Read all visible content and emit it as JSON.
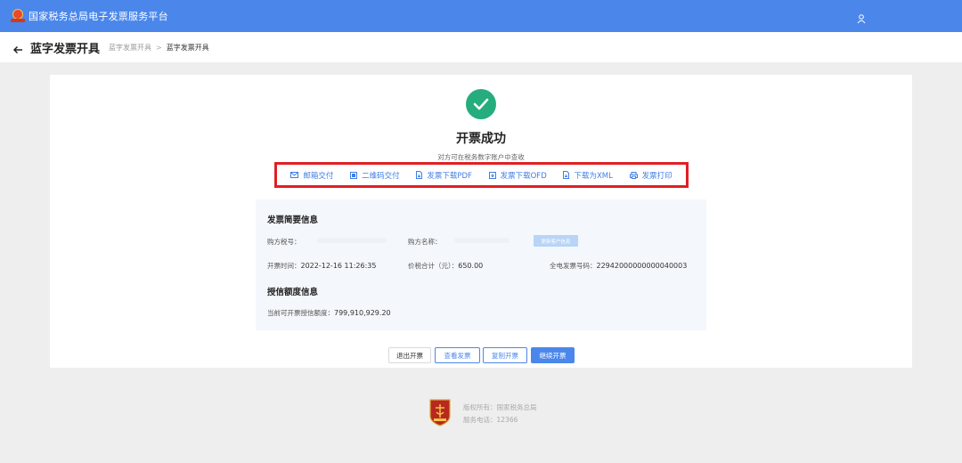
{
  "header": {
    "app_title": "国家税务总局电子发票服务平台",
    "logo_icon": "tax-bureau-logo-icon",
    "user_icon": "user-icon",
    "brand_color": "#4b87ea"
  },
  "subheader": {
    "back_icon": "arrow-left-icon",
    "page_title": "蓝字发票开具",
    "breadcrumb": [
      "蓝字发票开具",
      "蓝字发票开具"
    ],
    "breadcrumb_sep": ">"
  },
  "result": {
    "status_icon": "check-circle-icon",
    "success_color": "#26ad7d",
    "title": "开票成功",
    "hint": "对方可在税务数字账户中查收"
  },
  "delivery_actions": [
    {
      "label": "邮箱交付",
      "icon": "mail-icon"
    },
    {
      "label": "二维码交付",
      "icon": "qrcode-icon"
    },
    {
      "label": "发票下载PDF",
      "icon": "document-icon"
    },
    {
      "label": "发票下载OFD",
      "icon": "download-icon"
    },
    {
      "label": "下载为XML",
      "icon": "document-icon"
    },
    {
      "label": "发票打印",
      "icon": "printer-icon"
    }
  ],
  "highlight_color": "#e01f24",
  "invoice_summary": {
    "title": "发票简要信息",
    "buyer_tax_no_label": "购方税号：",
    "buyer_tax_no_value": "",
    "buyer_name_label": "购方名称：",
    "buyer_name_value": "",
    "update_customer_button": "更新客户信息",
    "issue_time_label": "开票时间：",
    "issue_time_value": "2022-12-16 11:26:35",
    "total_label": "价税合计（元）：",
    "total_value": "650.00",
    "invoice_no_label": "全电发票号码：",
    "invoice_no_value": "22942000000000040003"
  },
  "credit_info": {
    "title": "授信额度信息",
    "available_label": "当前可开票授信额度：",
    "available_value": "799,910,929.20"
  },
  "buttons": {
    "exit": "退出开票",
    "view": "查看发票",
    "copy": "复制开票",
    "continue": "继续开票"
  },
  "footer": {
    "emblem_icon": "tax-emblem-icon",
    "copyright": "版权所有：国家税务总局",
    "phone": "服务电话：12366"
  }
}
